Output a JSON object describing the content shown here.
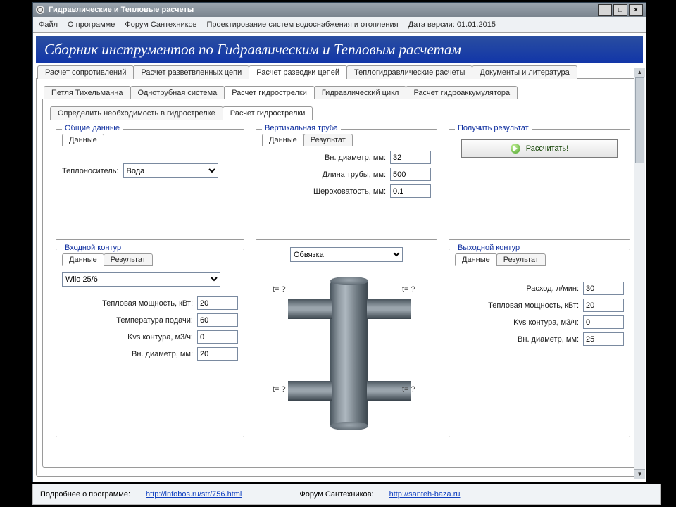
{
  "window": {
    "title": "Гидравлические и Тепловые расчеты"
  },
  "menu": {
    "file": "Файл",
    "about": "О программе",
    "forum": "Форум Сантехников",
    "design": "Проектирование систем водоснабжения и отопления",
    "date": "Дата версии: 01.01.2015"
  },
  "banner": "Сборник инструментов по Гидравлическим и Тепловым расчетам",
  "tabs1": {
    "t0": "Расчет сопротивлений",
    "t1": "Расчет разветвленных цепи",
    "t2": "Расчет разводки цепей",
    "t3": "Теплогидравлические расчеты",
    "t4": "Документы и литература"
  },
  "tabs2": {
    "t0": "Петля Тихельманна",
    "t1": "Однотрубная система",
    "t2": "Расчет гидрострелки",
    "t3": "Гидравлический цикл",
    "t4": "Расчет гидроаккумулятора"
  },
  "tabs3": {
    "t0": "Определить необходимость в гидрострелке",
    "t1": "Расчет гидрострелки"
  },
  "groups": {
    "common": {
      "legend": "Общие данные",
      "tab_data": "Данные",
      "medium_label": "Теплоноситель:",
      "medium_value": "Вода"
    },
    "vpipe": {
      "legend": "Вертикальная труба",
      "tab_data": "Данные",
      "tab_res": "Результат",
      "d_label": "Вн. диаметр, мм:",
      "d_value": "32",
      "len_label": "Длина трубы, мм:",
      "len_value": "500",
      "rough_label": "Шероховатость, мм:",
      "rough_value": "0.1"
    },
    "result": {
      "legend": "Получить результат",
      "button": "Рассчитать!"
    },
    "inlet": {
      "legend": "Входной контур",
      "tab_data": "Данные",
      "tab_res": "Результат",
      "pump_value": "Wilo 25/6",
      "power_label": "Тепловая мощность, кВт:",
      "power_value": "20",
      "tsup_label": "Температура подачи:",
      "tsup_value": "60",
      "kvs_label": "Kvs контура, м3/ч:",
      "kvs_value": "0",
      "d_label": "Вн. диаметр, мм:",
      "d_value": "20"
    },
    "mid": {
      "scheme_value": "Обвязка",
      "l1": "t= ?",
      "l2": "t= ?",
      "l3": "t= ?",
      "l4": "t= ?"
    },
    "outlet": {
      "legend": "Выходной контур",
      "tab_data": "Данные",
      "tab_res": "Результат",
      "flow_label": "Расход, л/мин:",
      "flow_value": "30",
      "power_label": "Тепловая мощность, кВт:",
      "power_value": "20",
      "kvs_label": "Kvs контура, м3/ч:",
      "kvs_value": "0",
      "d_label": "Вн. диаметр, мм:",
      "d_value": "25"
    }
  },
  "footer": {
    "more_label": "Подробнее о программе:",
    "more_link": "http://infobos.ru/str/756.html",
    "forum_label": "Форум Сантехников:",
    "forum_link": "http://santeh-baza.ru"
  }
}
